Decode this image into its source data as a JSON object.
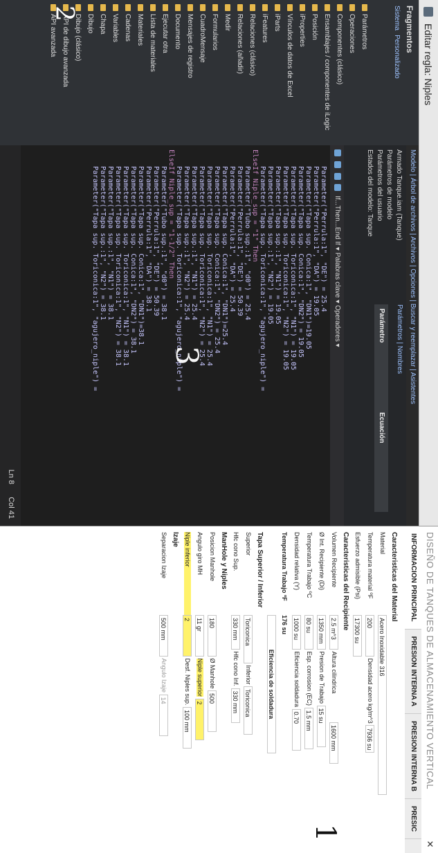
{
  "dialog": {
    "title": "Editar regla: Niples",
    "library": {
      "heading": "Fragmentos",
      "tabs": [
        "Sistema",
        "Personalizado"
      ],
      "items": [
        "Parámetros",
        "Operaciones",
        "Componentes (clásico)",
        "Ensamblajes / componentes de iLogic",
        "Posición",
        "iProperties",
        "Vínculos de datos de Excel",
        "iParts",
        "iFeatures",
        "Relaciones (clásico)",
        "Relaciones (añadir)",
        "Medir",
        "Formularios",
        "CuadroMensaje",
        "Mensajes de registro",
        "Documento",
        "Ejecutar otra",
        "Lista de materiales",
        "Materiales",
        "Cadenas",
        "Variables",
        "Chapa",
        "Dibujo",
        "Dibujo (clásico)",
        "API de dibujo avanzada",
        "API avanzada"
      ]
    },
    "editor_tabs": "Modelo | Árbol de archivos | Archivos | Opciones | Buscar y reemplazar | Asistentes",
    "param_tree": [
      "Armado Tanque.iam (Tanque)",
      "Parámetros de modelo",
      "Parámetros del usuario",
      "Estados del modelo: Tanque"
    ],
    "param_tabs": "Parámetros | Nombres",
    "param_cols": [
      "Parámetro",
      "Ecuación"
    ],
    "toolbar": "If...Then...End If  ▾  Palabras clave  ▾  Operadores ▾",
    "code_lines": [
      [
        "Parameter(\"Perrula:1\", \"DE\") = 25.4"
      ],
      [
        "Parameter(\"Perrula:1\", \"DA\") = 19.05"
      ],
      [
        "Parameter(\"Tapa sup. Conica:1\", \"DN1\")=19.05"
      ],
      [
        "Parameter(\"Tapa sup. Conica:1\", \"DN2\") = 19.05"
      ],
      [
        "Parameter(\"Tapa sup. Toriconica:1\", \"N1\") = 19.05"
      ],
      [
        "Parameter(\"Tapa sup. Toriconica:1\", \"N2\") = 19.05"
      ],
      [
        "Parameter(\"Tapa sup.:1\", \"N1\") = 19.05"
      ],
      [
        "Parameter(\"Tapa sup.:1\", \"N2\") = 19.05"
      ],
      [
        "Parameter(\"Tapa sup. Toriconica:1\", \"agujero_niple\") ="
      ],
      [
        ""
      ],
      [
        "ElseIf Niple_sup = \"1\" Then"
      ],
      [
        "Parameter(\"Tubo sup.:1\", \"d0\") = 25.4"
      ],
      [
        "Parameter(\"Perrula:1\", \"DE\") = 50.39"
      ],
      [
        "Parameter(\"Perrula:1\", \"DA\") = 25.4"
      ],
      [
        "Parameter(\"Tapa sup. Conica:1\", \"DN1\")=25.4"
      ],
      [
        "Parameter(\"Tapa sup. Conica:1\", \"DN2\") = 25.4"
      ],
      [
        "Parameter(\"Tapa sup. Toriconica:1\", \"N1\") = 25.4"
      ],
      [
        "Parameter(\"Tapa sup. Toriconica:1\", \"N2\") = 25.4"
      ],
      [
        "Parameter(\"Tapa sup.:1\", \"N1\") = 25.4"
      ],
      [
        "Parameter(\"Tapa sup.:1\", \"N2\") = 25.4"
      ],
      [
        "Parameter(\"Tapa sup. Toriconica:1\", \"agujero_niple\") ="
      ],
      [
        ""
      ],
      [
        "ElseIf Niple_sup = \"1-1/2\" Then"
      ],
      [
        "Parameter(\"Tubo sup.:1\", \"d0\") = 38.1"
      ],
      [
        "Parameter(\"Perrula:1\", \"DE\") = 50.39"
      ],
      [
        "Parameter(\"Perrula:1\", \"DA\") = 38.1"
      ],
      [
        "Parameter(\"Tapa sup. Conica:1\", \"DN1\")=38.1"
      ],
      [
        "Parameter(\"Tapa sup. Conica:1\", \"DN2\") = 38.1"
      ],
      [
        "Parameter(\"Tapa sup. Toriconica:1\", \"N1\") = 38.1"
      ],
      [
        "Parameter(\"Tapa sup. Toriconica:1\", \"N2\") = 38.1"
      ],
      [
        "Parameter(\"Tapa sup.:1\", \"N1\") = 38.1"
      ],
      [
        "Parameter(\"Tapa sup.:1\", \"N2\") = 38.1"
      ],
      [
        "Parameter(\"Tapa sup. Toriconica:1\", \"agujero_niple\") ="
      ]
    ],
    "status_ln": "Ln 8",
    "status_col": "Col 41"
  },
  "form": {
    "title": "DISEÑO DE TANQUES DE ALMACENAMIENTO VERTICAL",
    "tabs": [
      "INFORMACION PRINCIPAL",
      "PRESION INTERNA A",
      "PRESION INTERNA B",
      "PRESIC"
    ],
    "sec_material": "Caracteristicas del Material",
    "material_lbl": "Material",
    "material_val": "Acero Inoxidable 316",
    "temp_lbl": "Temperatura material ºF",
    "temp_val": "200",
    "dens_lbl": "Densidad acero kg/m^3",
    "dens_val": "7936 su",
    "esf_lbl": "Esfuerzo admisible (Psi)",
    "esf_val": "17300 su",
    "sec_recip": "Caracteristicas del Recipiente",
    "vol_lbl": "Volumen Recipiente",
    "vol_val": "2.5 m^3",
    "alt_lbl": "Altura cilindrica",
    "alt_val": "1600 mm",
    "di_lbl": "Ø Int. Recipiente (Di)",
    "di_val": "1350 mm",
    "pt_lbl": "Presion de Trabajo",
    "pt_val": "15 su",
    "tt_lbl": "Temperatura Trabajo ºC",
    "tt_val": "80 su",
    "ec_lbl": "Esp. corrosion (EC)",
    "ec_val": "1.5 mm",
    "dr_lbl": "Densidad relativa (Y)",
    "dr_val": "1000 su",
    "es_lbl": "Eficiencia soldadura",
    "es_val": "0.70",
    "ttf_lbl": "Temperatura Trabajo ºF",
    "ttf_val": "176 su",
    "ef_btn": "Eficiencia de soldadura",
    "sec_tapa": "Tapa Superior / Inferior",
    "sup_lbl": "Superior",
    "sup_val": "Toriconica",
    "inf_lbl": "Inferior",
    "inf_val": "Toriconica",
    "hcs_lbl": "Hfc cono Sup.",
    "hcs_val": "330 mm",
    "hci_lbl": "Hfc cono Inf.",
    "hci_val": "330 mm",
    "sec_man": "ManHole y Niples",
    "pm_lbl": "Posicion Manhole",
    "pm_val": "180",
    "om_lbl": "Ø Manhole",
    "om_val": "500",
    "ag_lbl": "Angulo giro MH",
    "ag_val": "11 gr",
    "ns_lbl": "Niple superior",
    "ns_val": "2",
    "ni_lbl": "Niple inferior",
    "ni_val": "2",
    "dn_lbl": "Desf. Niples sup.",
    "dn_val": "100 mm",
    "sec_izaje": "Izaje",
    "si_lbl": "Separacion Izaje",
    "si_val": "500 mm",
    "ai_lbl": "Angulo Izaje",
    "ai_val": "14"
  },
  "annotations": {
    "one": "1",
    "two": "2",
    "three": "3"
  }
}
